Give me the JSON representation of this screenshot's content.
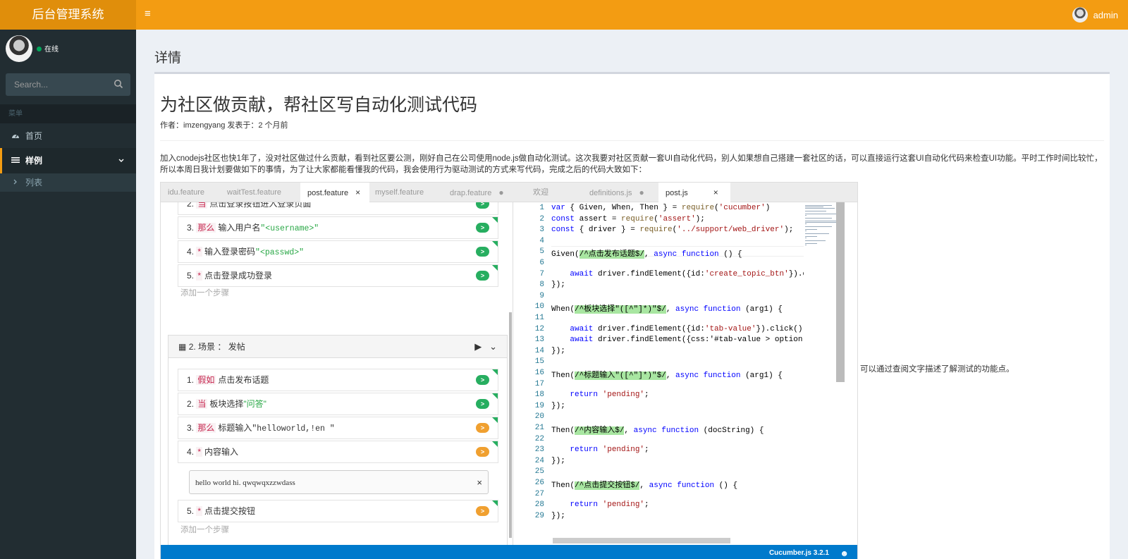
{
  "app": {
    "title": "后台管理系统",
    "menu_toggle_glyph": "≡"
  },
  "user": {
    "name": "admin",
    "status": "在线"
  },
  "search": {
    "placeholder": "Search..."
  },
  "sidebar": {
    "header": "菜单",
    "items": [
      {
        "label": "首页",
        "icon": "dashboard-icon"
      },
      {
        "label": "样例",
        "icon": "list-icon",
        "expanded": true,
        "children": [
          {
            "label": "列表",
            "icon": "chevron-right-icon"
          }
        ]
      }
    ]
  },
  "page": {
    "title": "详情"
  },
  "article": {
    "title": "为社区做贡献，帮社区写自动化测试代码",
    "meta": "作者：imzengyang 发表于：2 个月前",
    "paragraph": "加入cnodejs社区也快1年了，没对社区做过什么贡献，看到社区要公测，刚好自己在公司使用node.js做自动化测试。这次我要对社区贡献一套UI自动化代码，别人如果想自己搭建一套社区的话，可以直接运行这套UI自动化代码来检查UI功能。平时工作时间比较忙，所以本周日我计划要做如下的事情，为了让大家都能看懂我的代码，我会使用行为驱动测试的方式来写代码，完成之后的代码大致如下：",
    "side_note": "可以通过查阅文字描述了解测试的功能点。"
  },
  "editor": {
    "tabs": [
      {
        "label": "idu.feature"
      },
      {
        "label": "waitTest.feature"
      },
      {
        "label": "post.feature",
        "active": true,
        "close": "×"
      },
      {
        "label": "myself.feature"
      },
      {
        "label": "drap.feature",
        "dot": "●"
      },
      {
        "label": "欢迎"
      },
      {
        "label": "definitions.js",
        "dot": "●"
      },
      {
        "label": "post.js",
        "active": true,
        "close": "×"
      }
    ],
    "scenario1_steps": [
      {
        "num": "2.",
        "kw": "当",
        "text": "点击登录按钮进入登录页面"
      },
      {
        "num": "3.",
        "kw": "那么",
        "text": "输入用户名",
        "str": "\"<username>\""
      },
      {
        "num": "4.",
        "kw": "*",
        "text": "输入登录密码",
        "str": "\"<passwd>\""
      },
      {
        "num": "5.",
        "kw": "*",
        "text": "点击登录成功登录"
      }
    ],
    "add_step": "添加一个步骤",
    "scenario2_title": "2. 场景 ： 发帖",
    "scenario2_steps": [
      {
        "num": "1.",
        "kw": "假如",
        "text": "点击发布话题",
        "color": "green"
      },
      {
        "num": "2.",
        "kw": "当",
        "text": "板块选择",
        "str": "\"问答\"",
        "color": "green"
      },
      {
        "num": "3.",
        "kw": "那么",
        "text": "标题输入",
        "mono": "\"helloworld,!en \"",
        "color": "orange"
      },
      {
        "num": "4.",
        "kw": "*",
        "text": "内容输入",
        "color": "orange"
      },
      {
        "num": "5.",
        "kw": "*",
        "text": "点击提交按钮",
        "color": "orange"
      }
    ],
    "docstring": "hello world hi. qwqwqxzzwdass",
    "docstring_close": "×",
    "step_run_glyph": ">",
    "scenario_run_glyph": "▶",
    "scenario_collapse_glyph": "⌄",
    "status_version": "Cucumber.js 3.2.1",
    "status_smile": "☻"
  },
  "code_lines": [
    "var { Given, When, Then } = require('cucumber')",
    "const assert = require('assert');",
    "const { driver } = require('../support/web_driver');",
    "",
    "Given(/^点击发布话题$/, async function () {",
    "",
    "    await driver.findElement({id:'create_topic_btn'}).cli",
    "});",
    "",
    "When(/^板块选择\"([^\"]*)\"$/, async function (arg1) {",
    "",
    "    await driver.findElement({id:'tab-value'}).click();",
    "    await driver.findElement({css:'#tab-value > option:nt",
    "});",
    "",
    "Then(/^标题输入\"([^\"]*)\"$/, async function (arg1) {",
    "",
    "    return 'pending';",
    "});",
    "",
    "Then(/^内容输入$/, async function (docString) {",
    "",
    "    return 'pending';",
    "});",
    "",
    "Then(/^点击提交按钮$/, async function () {",
    "",
    "    return 'pending';",
    "});"
  ]
}
